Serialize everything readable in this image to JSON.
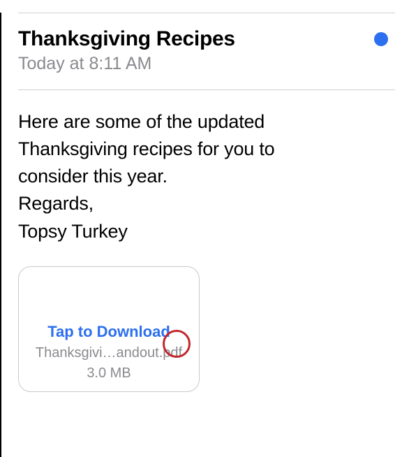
{
  "header": {
    "subject": "Thanksgiving Recipes",
    "timestamp": "Today at 8:11 AM"
  },
  "body": {
    "line1": "Here are some of the updated",
    "line2": "Thanksgiving recipes for you to",
    "line3": "consider this year.",
    "line4": "Regards,",
    "line5": "Topsy Turkey"
  },
  "attachment": {
    "action_label": "Tap to Download",
    "file_name": "Thanksgivi…andout.pdf",
    "file_size": "3.0 MB"
  }
}
